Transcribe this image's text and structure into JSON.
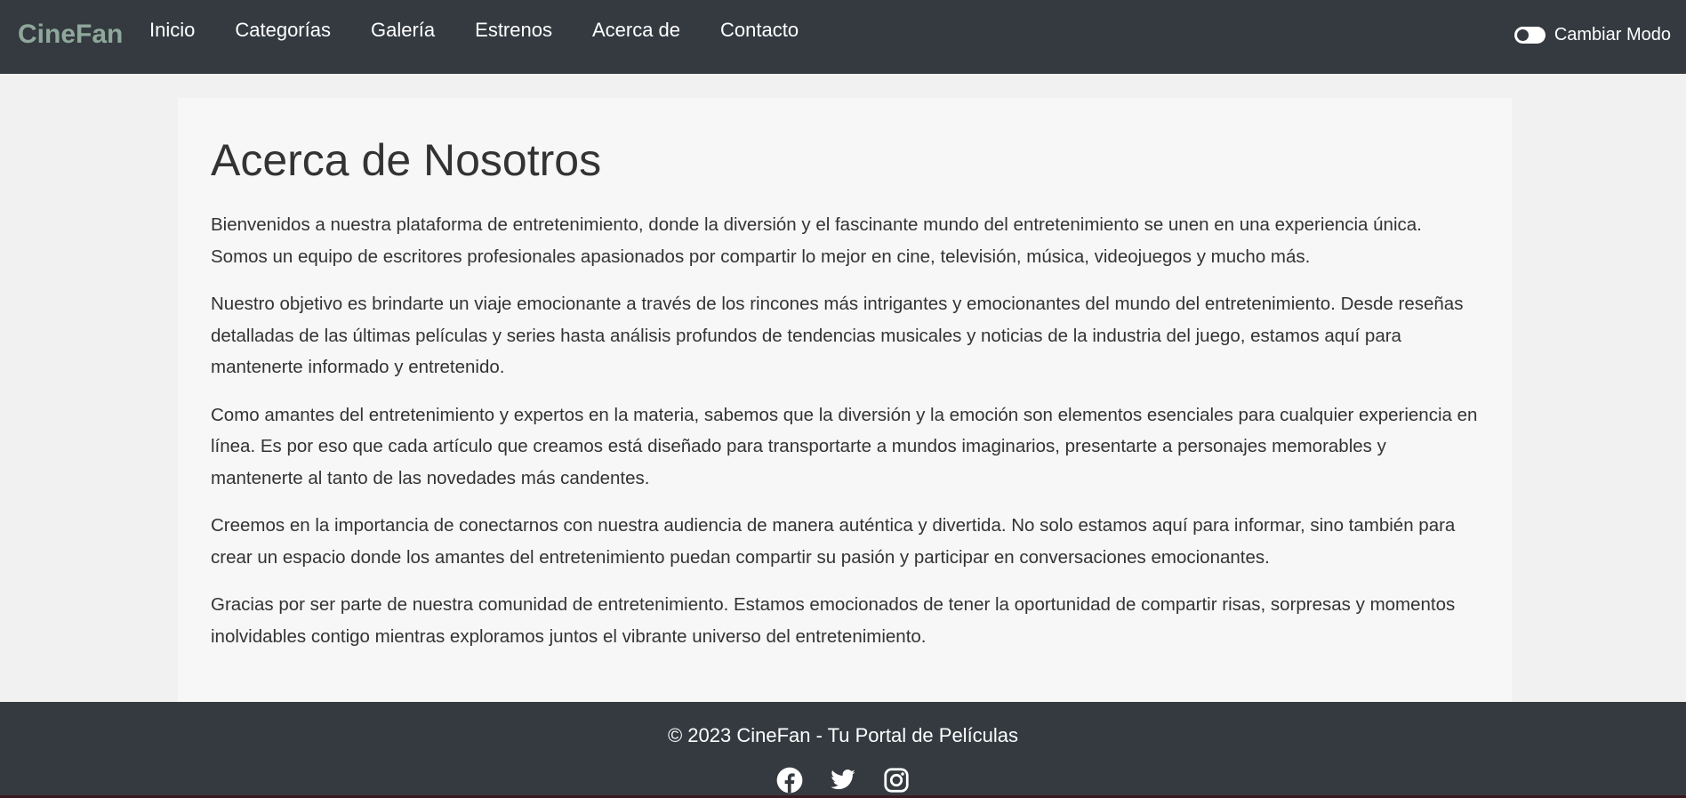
{
  "navbar": {
    "brand": "CineFan",
    "items": [
      {
        "label": "Inicio"
      },
      {
        "label": "Categorías"
      },
      {
        "label": "Galería"
      },
      {
        "label": "Estrenos"
      },
      {
        "label": "Acerca de"
      },
      {
        "label": "Contacto"
      }
    ],
    "mode_toggle_label": "Cambiar Modo",
    "mode_toggle_state": "off"
  },
  "main": {
    "title": "Acerca de Nosotros",
    "paragraphs": [
      "Bienvenidos a nuestra plataforma de entretenimiento, donde la diversión y el fascinante mundo del entretenimiento se unen en una experiencia única. Somos un equipo de escritores profesionales apasionados por compartir lo mejor en cine, televisión, música, videojuegos y mucho más.",
      "Nuestro objetivo es brindarte un viaje emocionante a través de los rincones más intrigantes y emocionantes del mundo del entretenimiento. Desde reseñas detalladas de las últimas películas y series hasta análisis profundos de tendencias musicales y noticias de la industria del juego, estamos aquí para mantenerte informado y entretenido.",
      "Como amantes del entretenimiento y expertos en la materia, sabemos que la diversión y la emoción son elementos esenciales para cualquier experiencia en línea. Es por eso que cada artículo que creamos está diseñado para transportarte a mundos imaginarios, presentarte a personajes memorables y mantenerte al tanto de las novedades más candentes.",
      "Creemos en la importancia de conectarnos con nuestra audiencia de manera auténtica y divertida. No solo estamos aquí para informar, sino también para crear un espacio donde los amantes del entretenimiento puedan compartir su pasión y participar en conversaciones emocionantes.",
      "Gracias por ser parte de nuestra comunidad de entretenimiento. Estamos emocionados de tener la oportunidad de compartir risas, sorpresas y momentos inolvidables contigo mientras exploramos juntos el vibrante universo del entretenimiento."
    ]
  },
  "footer": {
    "copyright": "© 2023 CineFan - Tu Portal de Películas",
    "social_icons": [
      "facebook-icon",
      "twitter-icon",
      "instagram-icon"
    ]
  },
  "colors": {
    "navbar_bg": "#343a40",
    "brand": "#8fa89b",
    "page_bg": "#f1f1f1",
    "card_bg": "#f7f7f7",
    "text": "#333333"
  }
}
